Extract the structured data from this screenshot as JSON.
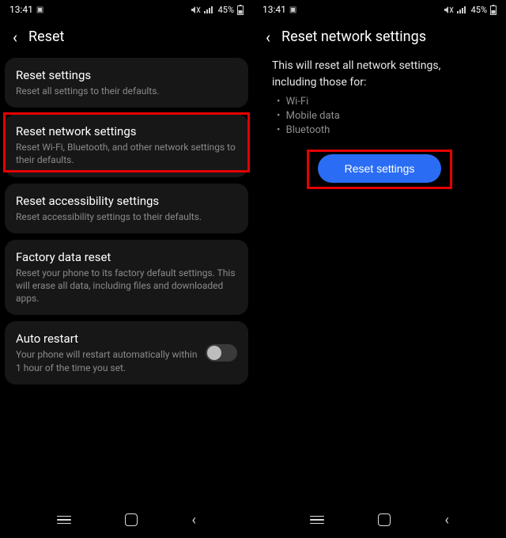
{
  "status": {
    "time": "13:41",
    "battery_text": "45%"
  },
  "left": {
    "title": "Reset",
    "items": [
      {
        "title": "Reset settings",
        "sub": "Reset all settings to their defaults."
      },
      {
        "title": "Reset network settings",
        "sub": "Reset Wi-Fi, Bluetooth, and other network settings to their defaults."
      },
      {
        "title": "Reset accessibility settings",
        "sub": "Reset accessibility settings to their defaults."
      },
      {
        "title": "Factory data reset",
        "sub": "Reset your phone to its factory default settings. This will erase all data, including files and downloaded apps."
      }
    ],
    "auto": {
      "title": "Auto restart",
      "sub": "Your phone will restart automatically within 1 hour of the time you set."
    }
  },
  "right": {
    "title": "Reset network settings",
    "intro": "This will reset all network settings, including those for:",
    "bullets": [
      "Wi-Fi",
      "Mobile data",
      "Bluetooth"
    ],
    "button": "Reset settings"
  }
}
